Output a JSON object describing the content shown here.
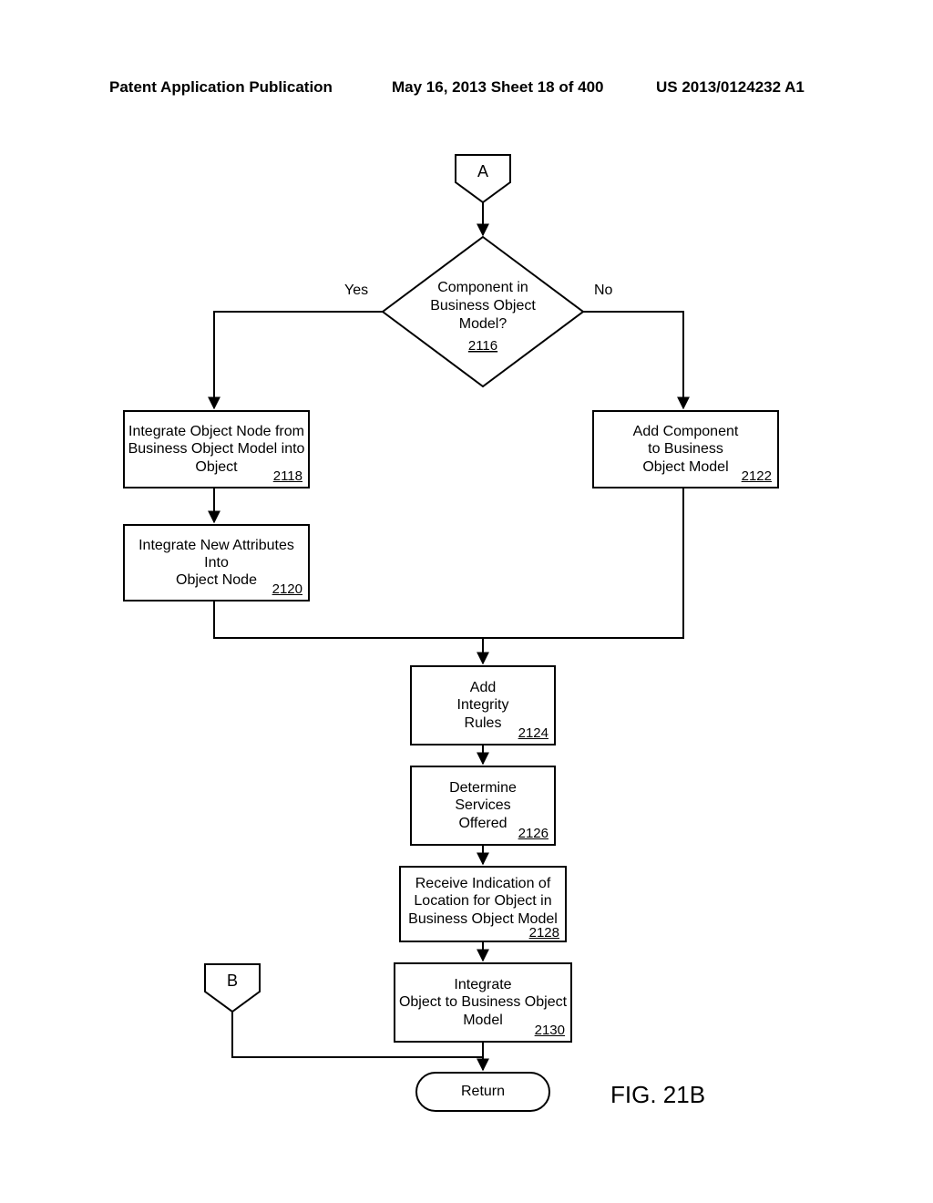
{
  "header": {
    "left": "Patent Application Publication",
    "mid": "May 16, 2013  Sheet 18 of 400",
    "right": "US 2013/0124232 A1"
  },
  "connectors": {
    "A": "A",
    "B": "B"
  },
  "decision": {
    "text_l1": "Component in",
    "text_l2": "Business Object",
    "text_l3": "Model?",
    "ref": "2116",
    "yes": "Yes",
    "no": "No"
  },
  "boxes": {
    "b2118": {
      "l1": "Integrate Object Node from",
      "l2": "Business Object Model into",
      "l3": "Object",
      "ref": "2118"
    },
    "b2120": {
      "l1": "Integrate New Attributes Into",
      "l2": "Object Node",
      "ref": "2120"
    },
    "b2122": {
      "l1": "Add Component",
      "l2": "to Business",
      "l3": "Object Model",
      "ref": "2122"
    },
    "b2124": {
      "l1": "Add",
      "l2": "Integrity",
      "l3": "Rules",
      "ref": "2124"
    },
    "b2126": {
      "l1": "Determine",
      "l2": "Services",
      "l3": "Offered",
      "ref": "2126"
    },
    "b2128": {
      "l1": "Receive Indication of",
      "l2": "Location for Object in",
      "l3": "Business Object Model",
      "ref": "2128"
    },
    "b2130": {
      "l1": "Integrate",
      "l2": "Object to Business Object",
      "l3": "Model",
      "ref": "2130"
    }
  },
  "return_label": "Return",
  "figure_label": "FIG. 21B",
  "chart_data": {
    "type": "flowchart",
    "title": "FIG. 21B",
    "nodes": [
      {
        "id": "A",
        "kind": "offpage-connector",
        "label": "A"
      },
      {
        "id": "2116",
        "kind": "decision",
        "label": "Component in Business Object Model?"
      },
      {
        "id": "2118",
        "kind": "process",
        "label": "Integrate Object Node from Business Object Model into Object"
      },
      {
        "id": "2120",
        "kind": "process",
        "label": "Integrate New Attributes Into Object Node"
      },
      {
        "id": "2122",
        "kind": "process",
        "label": "Add Component to Business Object Model"
      },
      {
        "id": "2124",
        "kind": "process",
        "label": "Add Integrity Rules"
      },
      {
        "id": "2126",
        "kind": "process",
        "label": "Determine Services Offered"
      },
      {
        "id": "2128",
        "kind": "process",
        "label": "Receive Indication of Location for Object in Business Object Model"
      },
      {
        "id": "2130",
        "kind": "process",
        "label": "Integrate Object to Business Object Model"
      },
      {
        "id": "B",
        "kind": "offpage-connector",
        "label": "B"
      },
      {
        "id": "RET",
        "kind": "terminator",
        "label": "Return"
      }
    ],
    "edges": [
      {
        "from": "A",
        "to": "2116"
      },
      {
        "from": "2116",
        "to": "2118",
        "label": "Yes"
      },
      {
        "from": "2116",
        "to": "2122",
        "label": "No"
      },
      {
        "from": "2118",
        "to": "2120"
      },
      {
        "from": "2120",
        "to": "2124"
      },
      {
        "from": "2122",
        "to": "2124"
      },
      {
        "from": "2124",
        "to": "2126"
      },
      {
        "from": "2126",
        "to": "2128"
      },
      {
        "from": "2128",
        "to": "2130"
      },
      {
        "from": "B",
        "to": "RET"
      },
      {
        "from": "2130",
        "to": "RET"
      }
    ]
  }
}
